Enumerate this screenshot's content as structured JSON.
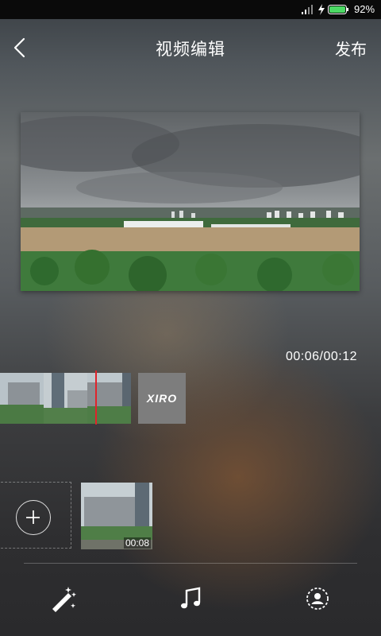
{
  "status_bar": {
    "battery_text": "92%"
  },
  "header": {
    "title": "视频编辑",
    "publish_label": "发布",
    "back_icon": "chevron-left-icon"
  },
  "player": {
    "time_display": "00:06/00:12"
  },
  "timeline": {
    "logo_text": "XIRO"
  },
  "clips": [
    {
      "duration": "00:08"
    }
  ],
  "toolbar": {
    "tools": [
      "magic-wand-icon",
      "music-note-icon",
      "user-circle-icon"
    ]
  },
  "colors": {
    "playhead": "#e0232b",
    "battery": "#4cd964"
  }
}
